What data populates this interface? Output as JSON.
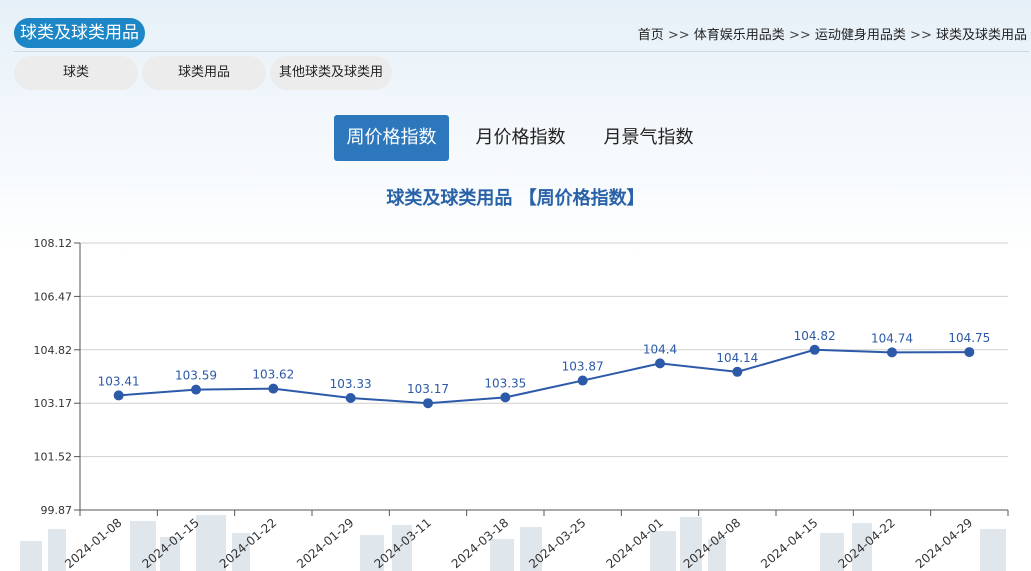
{
  "category": {
    "title": "球类及球类用品"
  },
  "breadcrumb": {
    "items": [
      "首页",
      "体育娱乐用品类",
      "运动健身用品类",
      "球类及球类用品"
    ],
    "separator": ">>"
  },
  "subcategories": [
    "球类",
    "球类用品",
    "其他球类及球类用"
  ],
  "tabs": [
    {
      "label": "周价格指数",
      "active": true
    },
    {
      "label": "月价格指数",
      "active": false
    },
    {
      "label": "月景气指数",
      "active": false
    }
  ],
  "colors": {
    "accent": "#2d78bd",
    "badge": "#1c86c6",
    "series": "#2c5aa8",
    "title": "#2a62a8"
  },
  "chart_data": {
    "type": "line",
    "title": "球类及球类用品 【周价格指数】",
    "xlabel": "",
    "ylabel": "",
    "ylim": [
      99.87,
      108.12
    ],
    "y_ticks": [
      "108.12",
      "106.47",
      "104.82",
      "103.17",
      "101.52",
      "99.87"
    ],
    "grid": true,
    "categories": [
      "2024-01-08",
      "2024-01-15",
      "2024-01-22",
      "2024-01-29",
      "2024-03-11",
      "2024-03-18",
      "2024-03-25",
      "2024-04-01",
      "2024-04-08",
      "2024-04-15",
      "2024-04-22",
      "2024-04-29"
    ],
    "series": [
      {
        "values": [
          103.41,
          103.59,
          103.62,
          103.33,
          103.17,
          103.35,
          103.87,
          104.4,
          104.14,
          104.82,
          104.74,
          104.75
        ],
        "labels": [
          "103.41",
          "103.59",
          "103.62",
          "103.33",
          "103.17",
          "103.35",
          "103.87",
          "104.4",
          "104.14",
          "104.82",
          "104.74",
          "104.75"
        ]
      }
    ]
  }
}
